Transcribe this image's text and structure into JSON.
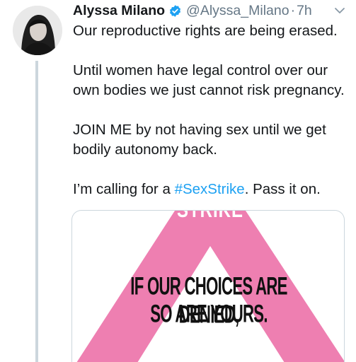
{
  "tweet": {
    "author_name": "Alyssa Milano",
    "handle": "@Alyssa_Milano",
    "separator": "·",
    "time": "7h",
    "icons": {
      "verified": "verified-badge-icon",
      "menu": "chevron-down-icon",
      "avatar": "profile-photo"
    },
    "colors": {
      "text": "#14171a",
      "muted": "#657786",
      "link": "#1da1f2",
      "thread_line": "#ccd6dd"
    },
    "text": {
      "para1": "Our reproductive rights are being erased.",
      "para2": "Until women have legal control over our own bodies we just cannot risk pregnancy.",
      "para3": "JOIN ME by not having sex until we get bodily autonomy back.",
      "para4_prefix": "I’m calling for a ",
      "hashtag": "#SexStrike",
      "para4_suffix": ". Pass it on."
    },
    "media": {
      "top_word": "STRIKE",
      "slogan_line1": "IF OUR CHOICES ARE DENIED,",
      "slogan_line2": "SO ARE YOURS.",
      "accent_color": "#ee7fb1"
    }
  }
}
